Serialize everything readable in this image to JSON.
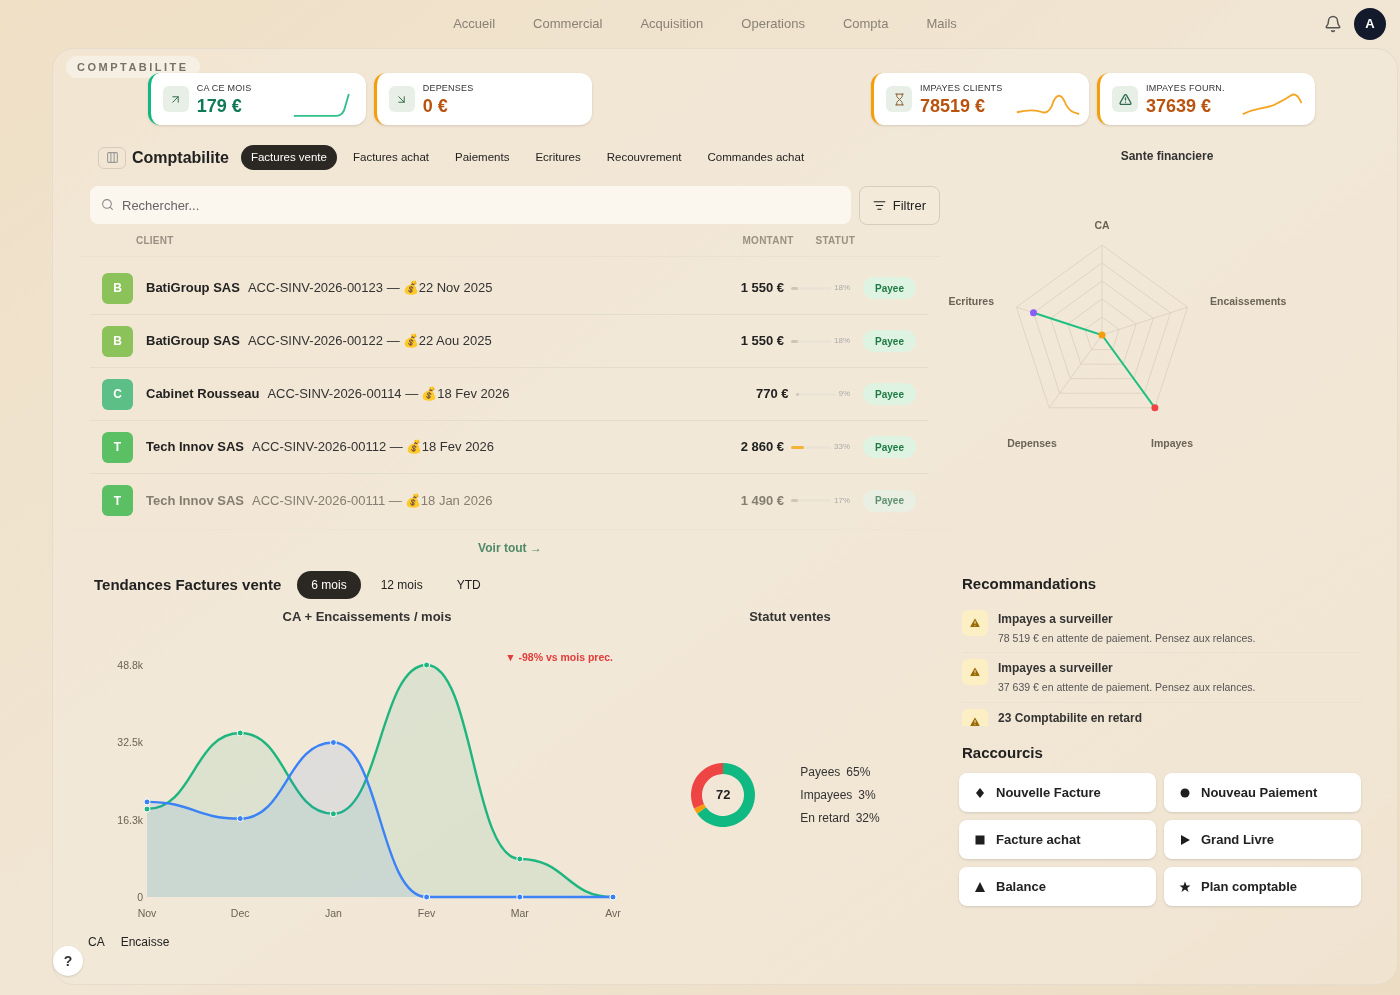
{
  "nav": {
    "links": [
      {
        "label": "Accueil",
        "selected": false
      },
      {
        "label": "Commercial",
        "selected": false
      },
      {
        "label": "Acquisition",
        "selected": false
      },
      {
        "label": "Operations",
        "selected": false
      },
      {
        "label": "Compta",
        "selected": false
      },
      {
        "label": "Mails",
        "selected": false
      }
    ],
    "avatar": "A"
  },
  "section_label": "COMPTABILITE",
  "kpis": [
    {
      "label": "CA CE MOIS",
      "value": "179 €",
      "color": "#10b981",
      "kind": "up"
    },
    {
      "label": "DEPENSES",
      "value": "0 €",
      "color": "#f59e0b",
      "kind": "down"
    },
    {
      "label": "IMPAYES CLIENTS",
      "value": "78519 €",
      "color": "#f59e0b",
      "kind": "hourglass"
    },
    {
      "label": "IMPAYES FOURN.",
      "value": "37639 €",
      "color": "#f59e0b",
      "kind": "warning"
    }
  ],
  "module": {
    "title": "Comptabilite",
    "tabs": [
      {
        "label": "Factures vente",
        "selected": true
      },
      {
        "label": "Factures achat",
        "selected": false
      },
      {
        "label": "Paiements",
        "selected": false
      },
      {
        "label": "Ecritures",
        "selected": false
      },
      {
        "label": "Recouvrement",
        "selected": false
      },
      {
        "label": "Commandes achat",
        "selected": false
      }
    ]
  },
  "search": {
    "placeholder": "Rechercher...",
    "filter_button": "Filtrer"
  },
  "table": {
    "columns": [
      "CLIENT",
      "MONTANT",
      "STATUT"
    ],
    "rows": [
      {
        "initial": "B",
        "color": "#8bc35a",
        "client": "BatiGroup SAS",
        "reference": "ACC-SINV-2026-00123 —",
        "icon": "💰",
        "date": "22 Nov 2025",
        "amount": "1 550 €",
        "level": 0.18,
        "percent": "18%",
        "highlight": false,
        "status": "Payee",
        "faded": false
      },
      {
        "initial": "B",
        "color": "#8bc35a",
        "client": "BatiGroup SAS",
        "reference": "ACC-SINV-2026-00122 —",
        "icon": "💰",
        "date": "22 Aou 2025",
        "amount": "1 550 €",
        "level": 0.18,
        "percent": "18%",
        "highlight": false,
        "status": "Payee",
        "faded": false
      },
      {
        "initial": "C",
        "color": "#5cbf85",
        "client": "Cabinet Rousseau",
        "reference": "ACC-SINV-2026-00114 —",
        "icon": "💰",
        "date": "18 Fev 2026",
        "amount": "770 €",
        "level": 0.09,
        "percent": "9%",
        "highlight": false,
        "status": "Payee",
        "faded": false
      },
      {
        "initial": "T",
        "color": "#5bbf64",
        "client": "Tech Innov SAS",
        "reference": "ACC-SINV-2026-00112 —",
        "icon": "💰",
        "date": "18 Fev 2026",
        "amount": "2 860 €",
        "level": 0.33,
        "percent": "33%",
        "highlight": true,
        "status": "Payee",
        "faded": false
      },
      {
        "initial": "T",
        "color": "#5bbf64",
        "client": "Tech Innov SAS",
        "reference": "ACC-SINV-2026-00111 —",
        "icon": "💰",
        "date": "18 Jan 2026",
        "amount": "1 490 €",
        "level": 0.17,
        "percent": "17%",
        "highlight": false,
        "status": "Payee",
        "faded": true
      }
    ],
    "see_all": "Voir tout →"
  },
  "trends": {
    "title": "Tendances Factures vente",
    "periods": [
      {
        "label": "6 mois",
        "selected": true
      },
      {
        "label": "12 mois",
        "selected": false
      },
      {
        "label": "YTD",
        "selected": false
      }
    ],
    "line_chart": {
      "chart_data": {
        "type": "area",
        "title": "CA + Encaissements / mois",
        "categories": [
          "Nov",
          "Dec",
          "Jan",
          "Fev",
          "Mar",
          "Avr"
        ],
        "ylim": [
          0,
          48800
        ],
        "yticks": [
          {
            "value": 0,
            "label": "0"
          },
          {
            "value": 16300,
            "label": "16.3k"
          },
          {
            "value": 32500,
            "label": "32.5k"
          },
          {
            "value": 48800,
            "label": "48.8k"
          }
        ],
        "series": [
          {
            "name": "CA",
            "color": "#1fb57f",
            "values": [
              18500,
              34500,
              17500,
              48800,
              8000,
              0
            ]
          },
          {
            "name": "Encaisse",
            "color": "#3b82f6",
            "values": [
              20000,
              16500,
              32500,
              0,
              0,
              0
            ]
          }
        ],
        "annotations": [
          "▼ -98% vs mois prec."
        ]
      }
    },
    "donut": {
      "chart_data": {
        "type": "donut",
        "title": "Statut ventes",
        "categories": [
          "Payees",
          "Impayees",
          "En retard"
        ],
        "series": [
          {
            "values": [
              65,
              3,
              32
            ]
          }
        ],
        "colors": [
          "#10b981",
          "#f59e0b",
          "#ef4444"
        ]
      },
      "center": "72",
      "legend_values": [
        "65%",
        "3%",
        "32%"
      ]
    }
  },
  "health": {
    "title": "Sante financiere",
    "axes": [
      "CA",
      "Encaissements",
      "Impayes",
      "Depenses",
      "Ecritures"
    ]
  },
  "recommendations": {
    "title": "Recommandations",
    "items": [
      {
        "title": "Impayes a surveiller",
        "text": "78 519 € en attente de paiement. Pensez aux relances."
      },
      {
        "title": "Impayes a surveiller",
        "text": "37 639 € en attente de paiement. Pensez aux relances."
      },
      {
        "title": "23 Comptabilite en retard"
      }
    ]
  },
  "shortcuts": {
    "title": "Raccourcis",
    "items": [
      {
        "label": "Nouvelle Facture",
        "kind": "diamond"
      },
      {
        "label": "Nouveau Paiement",
        "kind": "circle"
      },
      {
        "label": "Facture achat",
        "kind": "square"
      },
      {
        "label": "Grand Livre",
        "kind": "play"
      },
      {
        "label": "Balance",
        "kind": "triangle"
      },
      {
        "label": "Plan comptable",
        "kind": "star"
      }
    ]
  },
  "help": "?"
}
